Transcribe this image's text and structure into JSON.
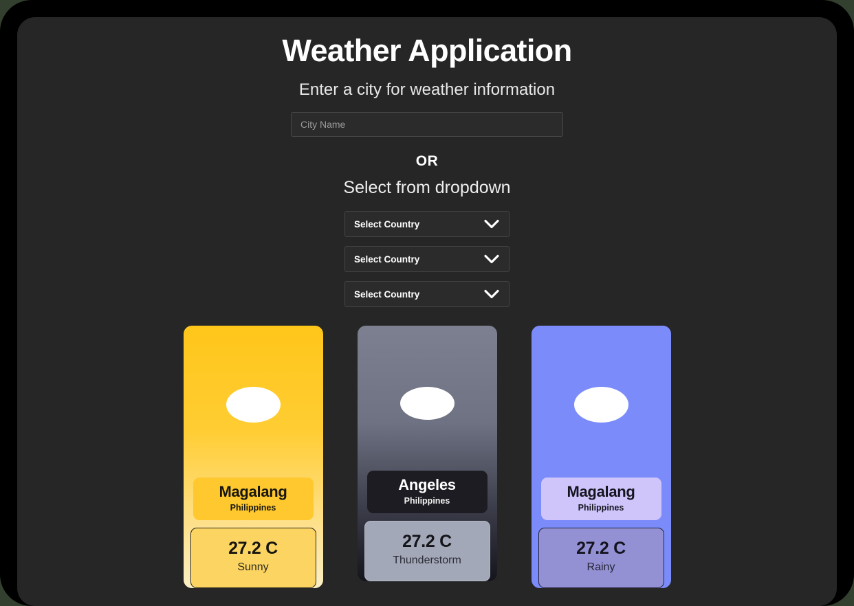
{
  "header": {
    "title": "Weather Application",
    "subtitle": "Enter a city for weather information"
  },
  "search": {
    "placeholder": "City Name",
    "value": ""
  },
  "divider": {
    "or_label": "OR"
  },
  "dropdown_section": {
    "heading": "Select from dropdown",
    "dropdowns": [
      {
        "label": "Select Country",
        "icon": "chevron-down-icon"
      },
      {
        "label": "Select Country",
        "icon": "chevron-down-icon"
      },
      {
        "label": "Select Country",
        "icon": "chevron-down-icon"
      }
    ]
  },
  "cards": [
    {
      "city": "Magalang",
      "country": "Philippines",
      "temperature": "27.2 C",
      "condition": "Sunny",
      "icon": "sun-icon",
      "accent": "#FFC61A",
      "pill_color": "#FFC82E",
      "temp_box_color": "#FBD462"
    },
    {
      "city": "Angeles",
      "country": "Philippines",
      "temperature": "27.2 C",
      "condition": "Thunderstorm",
      "icon": "cloud-icon",
      "accent": "#7D8090",
      "pill_color": "#1C1C22",
      "temp_box_color": "#A3A8B8"
    },
    {
      "city": "Magalang",
      "country": "Philippines",
      "temperature": "27.2 C",
      "condition": "Rainy",
      "icon": "rain-icon",
      "accent": "#7B8CFA",
      "pill_color": "#CFC5FB",
      "temp_box_color": "#9390D4"
    }
  ]
}
